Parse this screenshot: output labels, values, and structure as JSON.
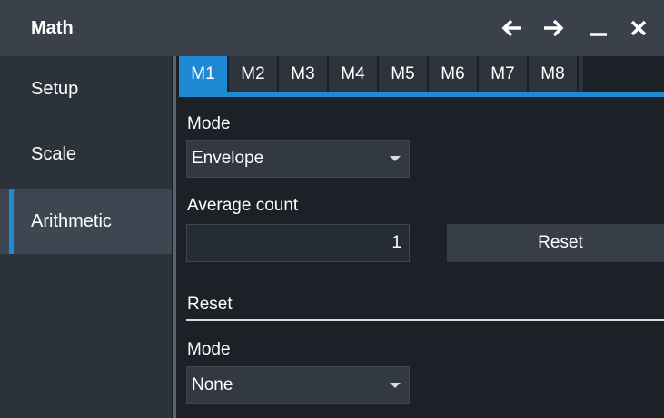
{
  "window": {
    "title": "Math",
    "controls": [
      "arrow-left-icon",
      "arrow-right-icon",
      "minimize-icon",
      "close-icon"
    ]
  },
  "sidebar": {
    "items": [
      {
        "label": "Setup",
        "active": false
      },
      {
        "label": "Scale",
        "active": false
      },
      {
        "label": "Arithmetic",
        "active": true
      }
    ]
  },
  "tabs": {
    "items": [
      "M1",
      "M2",
      "M3",
      "M4",
      "M5",
      "M6",
      "M7",
      "M8"
    ],
    "active": "M1"
  },
  "form": {
    "mode_label": "Mode",
    "mode_value": "Envelope",
    "average_count_label": "Average count",
    "average_count_value": "1",
    "reset_button": "Reset",
    "reset_section_label": "Reset",
    "reset_mode_label": "Mode",
    "reset_mode_value": "None"
  },
  "colors": {
    "accent": "#1e8ad6",
    "titlebar": "#3a414b",
    "sidebar": "#2c323a",
    "background": "#1c2128"
  }
}
